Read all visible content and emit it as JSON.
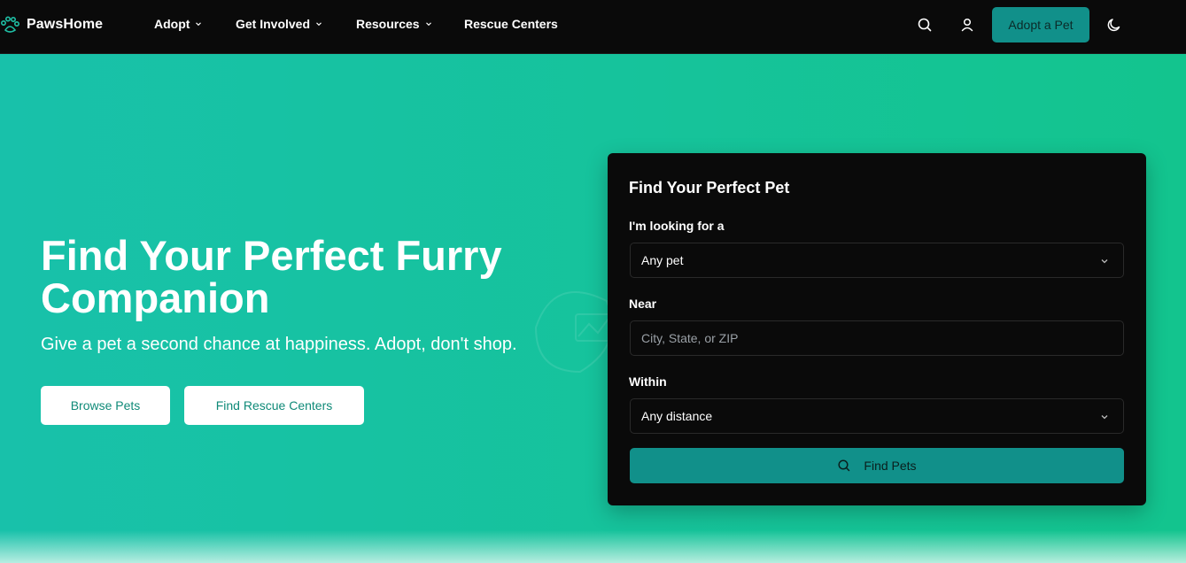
{
  "nav": {
    "brand": "PawsHome",
    "items": [
      {
        "label": "Adopt",
        "has_dropdown": true
      },
      {
        "label": "Get Involved",
        "has_dropdown": true
      },
      {
        "label": "Resources",
        "has_dropdown": true
      },
      {
        "label": "Rescue Centers",
        "has_dropdown": false
      }
    ],
    "icons": [
      "search-icon",
      "user-icon",
      "moon-icon"
    ],
    "cta_label": "Adopt a Pet"
  },
  "hero": {
    "title": "Find Your Perfect Furry Companion",
    "subtitle": "Give a pet a second chance at happiness. Adopt, don't shop.",
    "browse_label": "Browse Pets",
    "centers_label": "Find Rescue Centers"
  },
  "search_card": {
    "title": "Find Your Perfect Pet",
    "looking_label": "I'm looking for a",
    "looking_value": "Any pet",
    "near_label": "Near",
    "near_placeholder": "City, State, or ZIP",
    "within_label": "Within",
    "within_value": "Any distance",
    "submit_label": "Find Pets"
  },
  "colors": {
    "nav_bg": "#0a0a0a",
    "accent": "#11908a",
    "hero_start": "#18c1aa",
    "hero_end": "#13c48e",
    "hero_button_text": "#0f8a78"
  }
}
